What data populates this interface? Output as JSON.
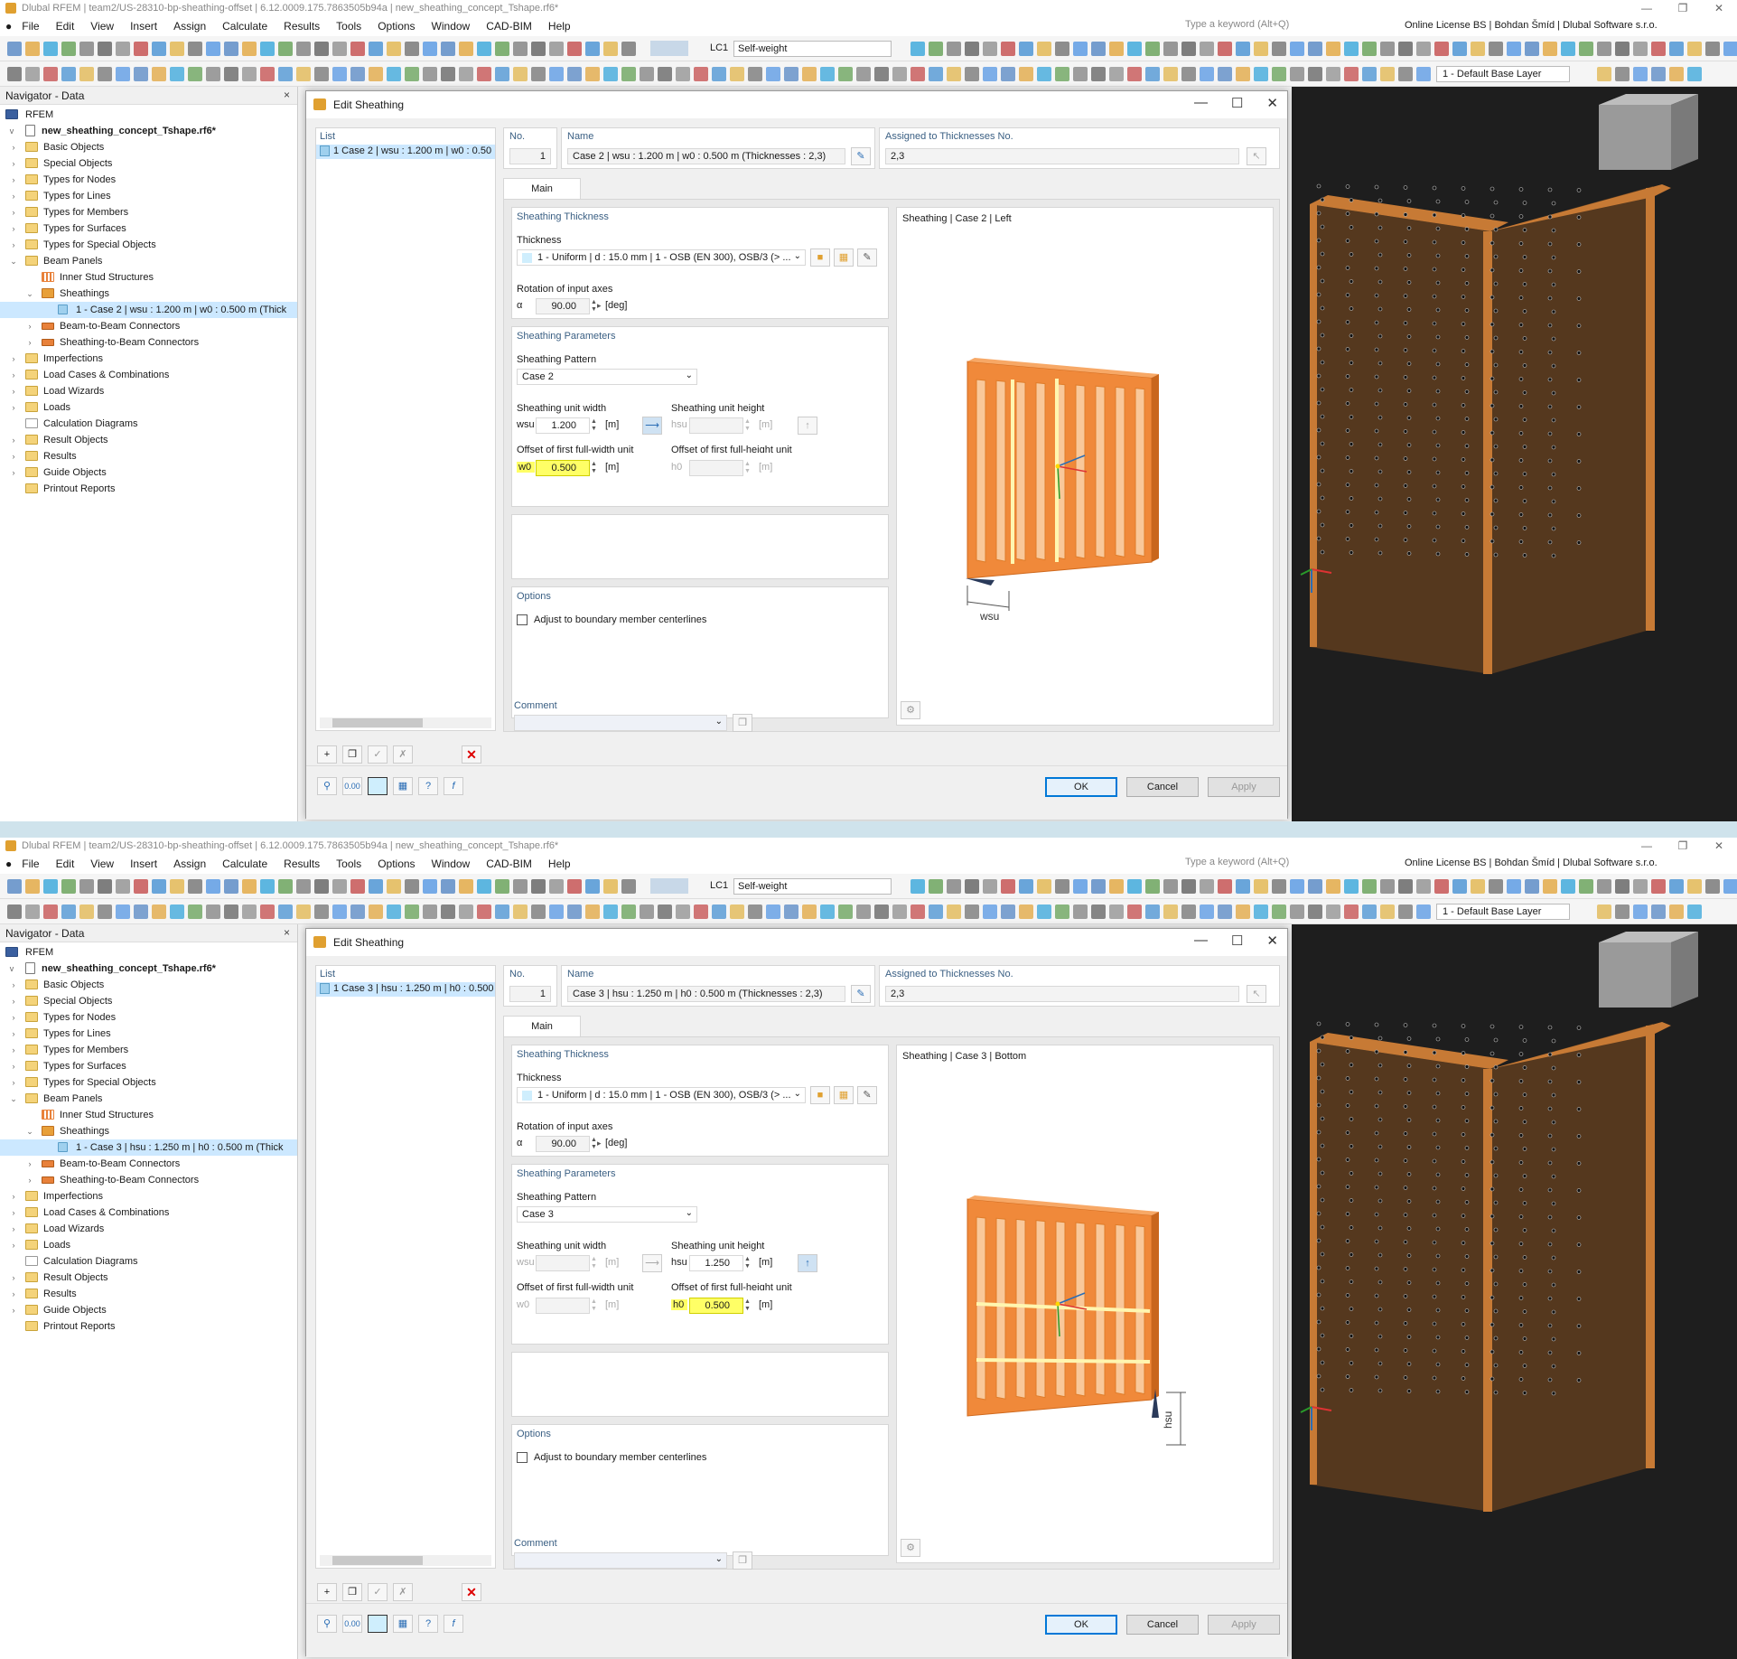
{
  "window1": {
    "title": "Dlubal RFEM | team2/US-28310-bp-sheathing-offset | 6.12.0009.175.7863505b94a | new_sheathing_concept_Tshape.rf6*",
    "menu": [
      "File",
      "Edit",
      "View",
      "Insert",
      "Assign",
      "Calculate",
      "Results",
      "Tools",
      "Options",
      "Window",
      "CAD-BIM",
      "Help"
    ],
    "search_placeholder": "Type a keyword (Alt+Q)",
    "license": "Online License BS | Bohdan Šmíd | Dlubal Software s.r.o.",
    "lc": "LC1",
    "lc_name": "Self-weight",
    "layer": "1 - Default Base Layer",
    "navigator": {
      "title": "Navigator - Data",
      "root": "RFEM",
      "file": "new_sheathing_concept_Tshape.rf6*",
      "items": [
        "Basic Objects",
        "Special Objects",
        "Types for Nodes",
        "Types for Lines",
        "Types for Members",
        "Types for Surfaces",
        "Types for Special Objects",
        "Beam Panels",
        "Inner Stud Structures",
        "Sheathings",
        "1 - Case 2 | wsu : 1.200 m | w0 : 0.500 m (Thick",
        "Beam-to-Beam Connectors",
        "Sheathing-to-Beam Connectors",
        "Imperfections",
        "Load Cases & Combinations",
        "Load Wizards",
        "Loads",
        "Calculation Diagrams",
        "Result Objects",
        "Results",
        "Guide Objects",
        "Printout Reports"
      ]
    },
    "dialog": {
      "title": "Edit Sheathing",
      "list_label": "List",
      "list_item": "1   Case 2 | wsu : 1.200 m | w0 : 0.50",
      "no_label": "No.",
      "no_value": "1",
      "name_label": "Name",
      "name_value": "Case 2 | wsu : 1.200 m | w0 : 0.500 m (Thicknesses : 2,3)",
      "assigned_label": "Assigned to Thicknesses No.",
      "assigned_value": "2,3",
      "tab_main": "Main",
      "thickness_section": "Sheathing Thickness",
      "thickness_label": "Thickness",
      "thickness_value": "1 - Uniform | d : 15.0 mm | 1 - OSB (EN 300), OSB/3 (> ...",
      "rotation_label": "Rotation of input axes",
      "alpha": "α",
      "alpha_value": "90.00",
      "deg": "[deg]",
      "params_section": "Sheathing Parameters",
      "pattern_label": "Sheathing Pattern",
      "pattern_value": "Case 2",
      "width_label": "Sheathing unit width",
      "height_label": "Sheathing unit height",
      "wsu": "wsu",
      "wsu_value": "1.200",
      "hsu": "hsu",
      "hsu_value": "",
      "unit_m": "[m]",
      "offset_w_label": "Offset of first full-width unit",
      "offset_h_label": "Offset of first full-height unit",
      "w0": "w0",
      "w0_value": "0.500",
      "h0": "h0",
      "h0_value": "",
      "options_section": "Options",
      "adjust_label": "Adjust to boundary member centerlines",
      "comment_label": "Comment",
      "preview_title": "Sheathing | Case 2 | Left",
      "dim_label": "wsu",
      "ok": "OK",
      "cancel": "Cancel",
      "apply": "Apply"
    }
  },
  "window2": {
    "title": "Dlubal RFEM | team2/US-28310-bp-sheathing-offset | 6.12.0009.175.7863505b94a | new_sheathing_concept_Tshape.rf6*",
    "menu": [
      "File",
      "Edit",
      "View",
      "Insert",
      "Assign",
      "Calculate",
      "Results",
      "Tools",
      "Options",
      "Window",
      "CAD-BIM",
      "Help"
    ],
    "search_placeholder": "Type a keyword (Alt+Q)",
    "license": "Online License BS | Bohdan Šmíd | Dlubal Software s.r.o.",
    "lc": "LC1",
    "lc_name": "Self-weight",
    "layer": "1 - Default Base Layer",
    "navigator": {
      "title": "Navigator - Data",
      "root": "RFEM",
      "file": "new_sheathing_concept_Tshape.rf6*",
      "items": [
        "Basic Objects",
        "Special Objects",
        "Types for Nodes",
        "Types for Lines",
        "Types for Members",
        "Types for Surfaces",
        "Types for Special Objects",
        "Beam Panels",
        "Inner Stud Structures",
        "Sheathings",
        "1 - Case 3 | hsu : 1.250 m | h0 : 0.500 m (Thick",
        "Beam-to-Beam Connectors",
        "Sheathing-to-Beam Connectors",
        "Imperfections",
        "Load Cases & Combinations",
        "Load Wizards",
        "Loads",
        "Calculation Diagrams",
        "Result Objects",
        "Results",
        "Guide Objects",
        "Printout Reports"
      ]
    },
    "dialog": {
      "title": "Edit Sheathing",
      "list_label": "List",
      "list_item": "1   Case 3 | hsu : 1.250 m | h0 : 0.500",
      "no_label": "No.",
      "no_value": "1",
      "name_label": "Name",
      "name_value": "Case 3 | hsu : 1.250 m | h0 : 0.500 m (Thicknesses : 2,3)",
      "assigned_label": "Assigned to Thicknesses No.",
      "assigned_value": "2,3",
      "tab_main": "Main",
      "thickness_section": "Sheathing Thickness",
      "thickness_label": "Thickness",
      "thickness_value": "1 - Uniform | d : 15.0 mm | 1 - OSB (EN 300), OSB/3 (> ...",
      "rotation_label": "Rotation of input axes",
      "alpha": "α",
      "alpha_value": "90.00",
      "deg": "[deg]",
      "params_section": "Sheathing Parameters",
      "pattern_label": "Sheathing Pattern",
      "pattern_value": "Case 3",
      "width_label": "Sheathing unit width",
      "height_label": "Sheathing unit height",
      "wsu": "wsu",
      "wsu_value": "",
      "hsu": "hsu",
      "hsu_value": "1.250",
      "unit_m": "[m]",
      "offset_w_label": "Offset of first full-width unit",
      "offset_h_label": "Offset of first full-height unit",
      "w0": "w0",
      "w0_value": "",
      "h0": "h0",
      "h0_value": "0.500",
      "options_section": "Options",
      "adjust_label": "Adjust to boundary member centerlines",
      "comment_label": "Comment",
      "preview_title": "Sheathing | Case 3 | Bottom",
      "dim_label": "hsu",
      "ok": "OK",
      "cancel": "Cancel",
      "apply": "Apply"
    }
  }
}
